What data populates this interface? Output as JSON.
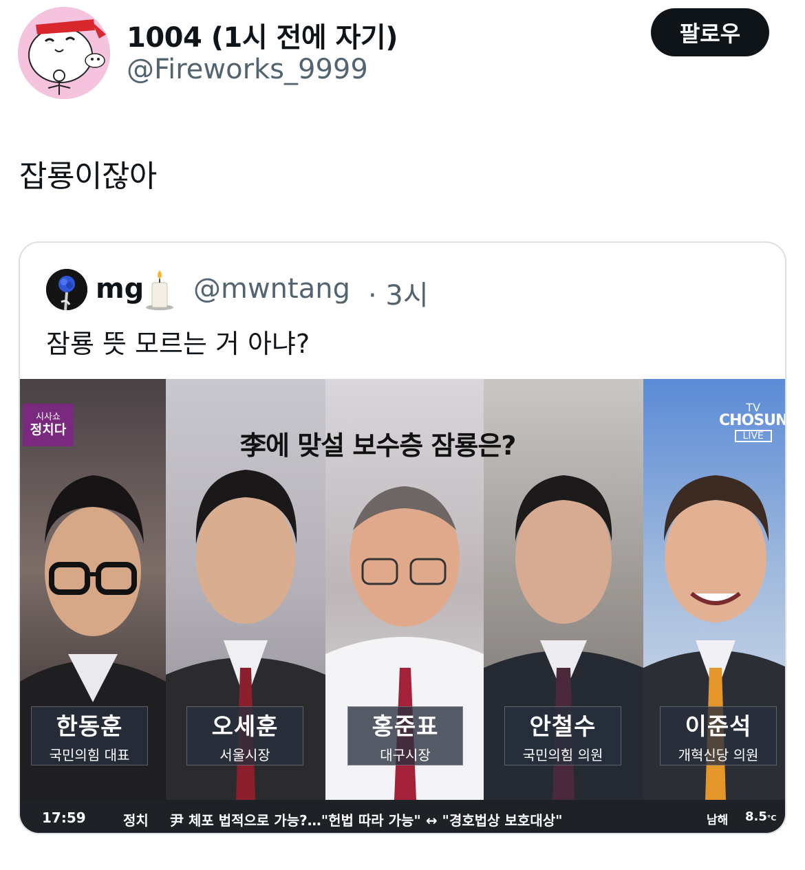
{
  "author": {
    "display_name": "1004 (1시 전에 자기)",
    "handle": "@Fireworks_9999",
    "follow_label": "팔로우"
  },
  "tweet": {
    "text": "잡룡이잖아"
  },
  "quote": {
    "name": "mg",
    "handle": "@mwntang",
    "time": "· 3시",
    "text": "잠룡 뜻 모르는 거 아냐?",
    "media": {
      "show_logo_small": "시사쇼",
      "show_logo_big": "정치다",
      "headline": "李에 맞설 보수층 잠룡은?",
      "channel": {
        "top": "TV",
        "name": "CHOSUN",
        "live": "LIVE"
      },
      "people": [
        {
          "name": "한동훈",
          "title": "국민의힘 대표"
        },
        {
          "name": "오세훈",
          "title": "서울시장"
        },
        {
          "name": "홍준표",
          "title": "대구시장"
        },
        {
          "name": "안철수",
          "title": "국민의힘 의원"
        },
        {
          "name": "이준석",
          "title": "개혁신당 의원"
        }
      ],
      "ticker": {
        "time": "17:59",
        "category": "정치",
        "news": "尹 체포 법적으로 가능?…\"헌법 따라 가능\" ↔ \"경호법상 보호대상\"",
        "region": "남해",
        "temp": "8.5",
        "unit": "°C"
      }
    }
  }
}
